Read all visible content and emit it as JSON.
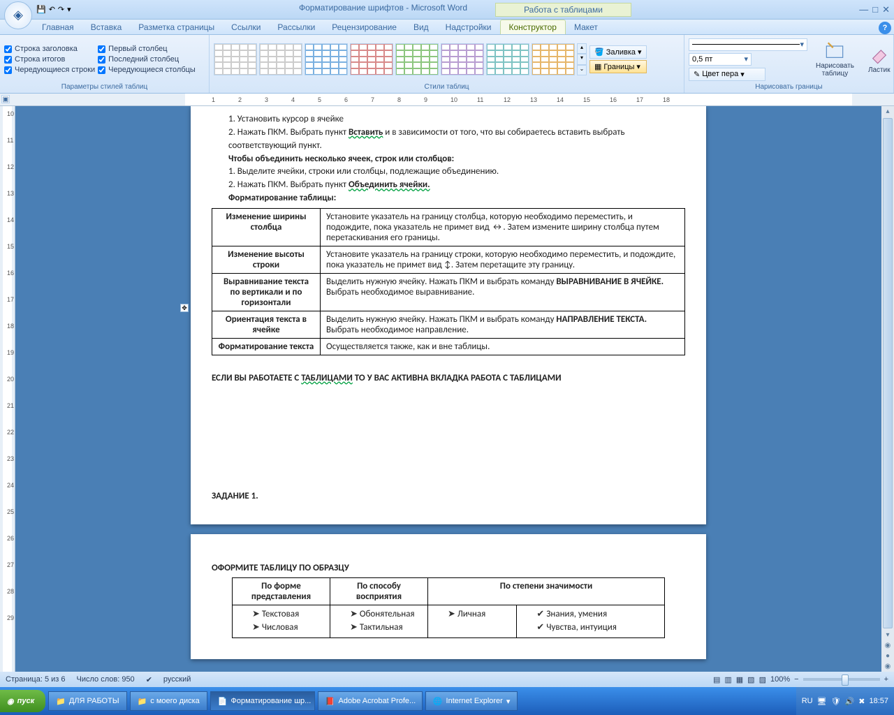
{
  "title": {
    "doc": "Форматирование шрифтов - Microsoft Word",
    "context": "Работа с таблицами"
  },
  "tabs": [
    "Главная",
    "Вставка",
    "Разметка страницы",
    "Ссылки",
    "Рассылки",
    "Рецензирование",
    "Вид",
    "Надстройки"
  ],
  "ctx_tabs": [
    "Конструктор",
    "Макет"
  ],
  "grp_options": {
    "label": "Параметры стилей таблиц",
    "left": [
      "Строка заголовка",
      "Строка итогов",
      "Чередующиеся строки"
    ],
    "right": [
      "Первый столбец",
      "Последний столбец",
      "Чередующиеся столбцы"
    ]
  },
  "grp_styles": {
    "label": "Стили таблиц",
    "fill": "Заливка",
    "borders": "Границы"
  },
  "grp_draw": {
    "label": "Нарисовать границы",
    "width": "0,5 пт",
    "pen": "Цвет пера",
    "draw": "Нарисовать таблицу",
    "erase": "Ластик"
  },
  "doc": {
    "l1": "1. Установить  курсор в ячейке",
    "l2a": "2. Нажать ПКМ. Выбрать пункт ",
    "l2b": "Вставить",
    "l2c": "  и  в зависимости от того, что вы собираетесь вставить выбрать соответствующий пункт.",
    "h1": "Чтобы объединить несколько ячеек, строк или столбцов:",
    "l3": "1. Выделите ячейки, строки или столбцы, подлежащие объединению.",
    "l4a": "2. Нажать ПКМ. Выбрать пункт ",
    "l4b": "Объединить ячейки.",
    "h2": "Форматирование таблицы:",
    "r1a": "Изменение ширины столбца",
    "r1b": "Установите указатель на границу столбца, которую необходимо переместить, и подождите, пока указатель не примет вид ↔. Затем измените ширину столбца путем перетаскивания его границы.",
    "r2a": "Изменение высоты строки",
    "r2b": "Установите указатель на границу строки, которую  необходимо переместить, и подождите, пока указатель не примет вид ↕. Затем перетащите эту границу.",
    "r3a": "Выравнивание текста по вертикали и по горизонтали",
    "r3b1": "Выделить нужную ячейку. Нажать ПКМ и выбрать команду ",
    "r3b2": "ВЫРАВНИВАНИЕ В ЯЧЕЙКЕ.",
    "r3b3": " Выбрать необходимое выравнивание.",
    "r4a": "Ориентация текста в ячейке",
    "r4b1": "Выделить нужную ячейку. Нажать ПКМ и выбрать команду ",
    "r4b2": "НАПРАВЛЕНИЕ ТЕКСТА.",
    "r4b3": " Выбрать необходимое направление.",
    "r5a": "Форматирование текста",
    "r5b": "Осуществляется также, как и вне таблицы.",
    "note1": "ЕСЛИ ВЫ РАБОТАЕТЕ С ",
    "note2": "ТАБЛИЦАМИ",
    "note3": " ТО У ВАС АКТИВНА ВКЛАДКА  ",
    "note4": "РАБОТА С ТАБЛИЦАМИ",
    "task": "ЗАДАНИЕ 1.",
    "p2h": "ОФОРМИТЕ ТАБЛИЦУ ПО ОБРАЗЦУ",
    "th1": "По форме представления",
    "th2": "По способу восприятия",
    "th3": "По степени значимости",
    "c1a": "Текстовая",
    "c1b": "Числовая",
    "c2a": "Обонятельная",
    "c2b": "Тактильная",
    "c3a": "Личная",
    "c4a": "Знания, умения",
    "c4b": "Чувства, интуиция"
  },
  "status": {
    "page": "Страница: 5 из 6",
    "words": "Число слов: 950",
    "lang": "русский",
    "zoom": "100%"
  },
  "taskbar": {
    "start": "пуск",
    "items": [
      "ДЛЯ РАБОТЫ",
      "с моего диска",
      "Форматирование шр...",
      "Adobe Acrobat Profe...",
      "Internet Explorer"
    ],
    "lang": "RU",
    "time": "18:57"
  }
}
